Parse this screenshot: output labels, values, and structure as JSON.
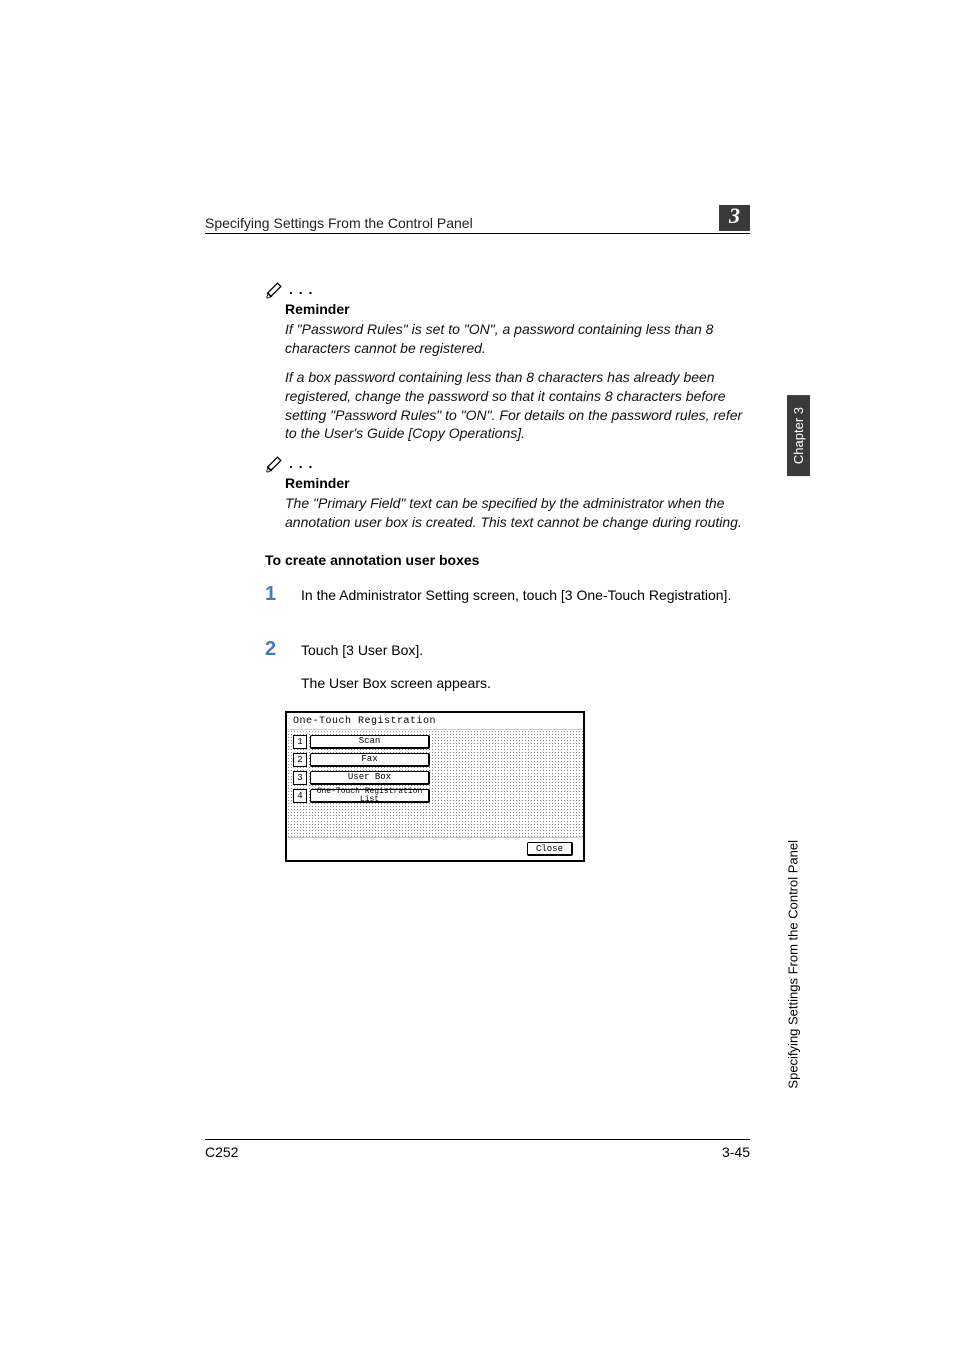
{
  "header": {
    "title": "Specifying Settings From the Control Panel",
    "chapter_number": "3"
  },
  "reminder1": {
    "heading": "Reminder",
    "p1": "If \"Password Rules\" is set to \"ON\", a password containing less than 8 characters cannot be registered.",
    "p2": "If a box password containing less than 8 characters has already been registered, change the password so that it contains 8 characters before setting \"Password Rules\" to \"ON\". For details on the password rules, refer to the User's Guide [Copy Operations]."
  },
  "reminder2": {
    "heading": "Reminder",
    "p1": "The \"Primary Field\" text can be specified by the administrator when the annotation user box is created. This text cannot be change during routing."
  },
  "section_heading": "To create annotation user boxes",
  "steps": {
    "s1": {
      "num": "1",
      "text": "In the Administrator Setting screen, touch [3 One-Touch Registration]."
    },
    "s2": {
      "num": "2",
      "text": "Touch [3 User Box].",
      "sub": "The User Box screen appears."
    }
  },
  "screen": {
    "title": "One-Touch Registration",
    "items": [
      {
        "num": "1",
        "label": "Scan"
      },
      {
        "num": "2",
        "label": "Fax"
      },
      {
        "num": "3",
        "label": "User Box"
      },
      {
        "num": "4",
        "label": "One-Touch Registration List"
      }
    ],
    "close": "Close"
  },
  "footer": {
    "left": "C252",
    "right": "3-45"
  },
  "side": {
    "label": "Specifying Settings From the Control Panel",
    "tab": "Chapter 3"
  }
}
